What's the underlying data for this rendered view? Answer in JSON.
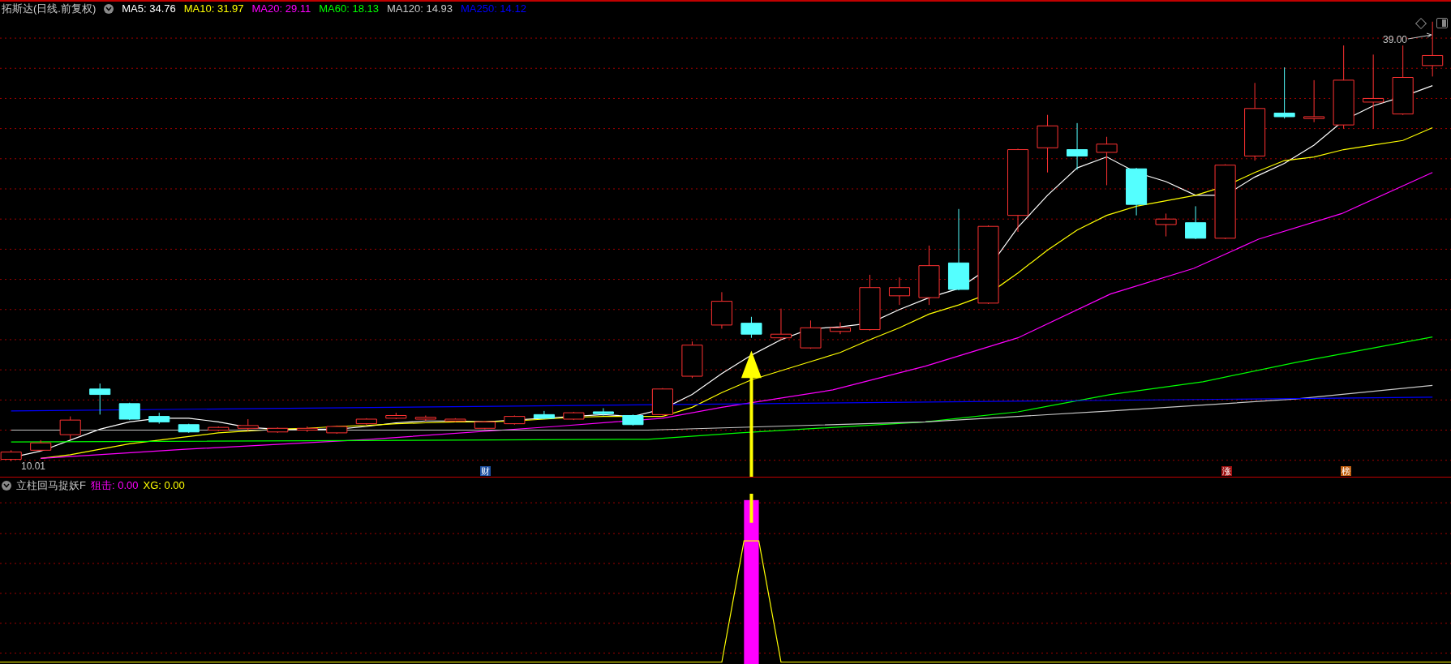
{
  "chart_header": {
    "title": "拓斯达(日线.前复权)",
    "ma_values": [
      {
        "label": "MA5: 34.76",
        "color": "#ffffff"
      },
      {
        "label": "MA10: 31.97",
        "color": "#ffff00"
      },
      {
        "label": "MA20: 29.11",
        "color": "#ff00ff"
      },
      {
        "label": "MA60: 18.13",
        "color": "#00ff00"
      },
      {
        "label": "MA120: 14.93",
        "color": "#c8c8c8"
      },
      {
        "label": "MA250: 14.12",
        "color": "#0000ff"
      }
    ]
  },
  "price_labels": {
    "high": "39.00",
    "low": "10.01"
  },
  "markers": [
    {
      "text": "财",
      "color": "#1c4fa0"
    },
    {
      "text": "涨",
      "color": "#a01010"
    },
    {
      "text": "榜",
      "color": "#c06010"
    }
  ],
  "indicator_header": {
    "title": "立柱回马捉妖F",
    "values": [
      {
        "label": "狙击: 0.00",
        "color": "#ff00ff"
      },
      {
        "label": "XG: 0.00",
        "color": "#ffff00"
      }
    ]
  }
}
